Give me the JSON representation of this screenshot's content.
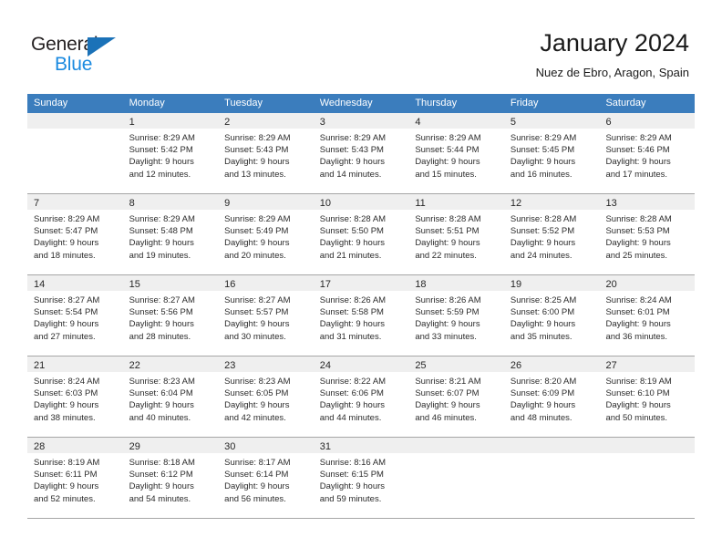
{
  "logo": {
    "word1": "General",
    "word2": "Blue",
    "triangle_color": "#1b72b8",
    "word1_color": "#231f20",
    "word2_color": "#1b8ae0"
  },
  "header": {
    "title": "January 2024",
    "subtitle": "Nuez de Ebro, Aragon, Spain"
  },
  "theme": {
    "header_row_bg": "#3b7dbd",
    "header_row_text": "#ffffff",
    "day_band_bg": "#efefef",
    "row_divider": "#a6a6a6"
  },
  "calendar": {
    "weekdays": [
      "Sunday",
      "Monday",
      "Tuesday",
      "Wednesday",
      "Thursday",
      "Friday",
      "Saturday"
    ],
    "weeks": [
      [
        {
          "day": "",
          "lines": []
        },
        {
          "day": "1",
          "lines": [
            "Sunrise: 8:29 AM",
            "Sunset: 5:42 PM",
            "Daylight: 9 hours",
            "and 12 minutes."
          ]
        },
        {
          "day": "2",
          "lines": [
            "Sunrise: 8:29 AM",
            "Sunset: 5:43 PM",
            "Daylight: 9 hours",
            "and 13 minutes."
          ]
        },
        {
          "day": "3",
          "lines": [
            "Sunrise: 8:29 AM",
            "Sunset: 5:43 PM",
            "Daylight: 9 hours",
            "and 14 minutes."
          ]
        },
        {
          "day": "4",
          "lines": [
            "Sunrise: 8:29 AM",
            "Sunset: 5:44 PM",
            "Daylight: 9 hours",
            "and 15 minutes."
          ]
        },
        {
          "day": "5",
          "lines": [
            "Sunrise: 8:29 AM",
            "Sunset: 5:45 PM",
            "Daylight: 9 hours",
            "and 16 minutes."
          ]
        },
        {
          "day": "6",
          "lines": [
            "Sunrise: 8:29 AM",
            "Sunset: 5:46 PM",
            "Daylight: 9 hours",
            "and 17 minutes."
          ]
        }
      ],
      [
        {
          "day": "7",
          "lines": [
            "Sunrise: 8:29 AM",
            "Sunset: 5:47 PM",
            "Daylight: 9 hours",
            "and 18 minutes."
          ]
        },
        {
          "day": "8",
          "lines": [
            "Sunrise: 8:29 AM",
            "Sunset: 5:48 PM",
            "Daylight: 9 hours",
            "and 19 minutes."
          ]
        },
        {
          "day": "9",
          "lines": [
            "Sunrise: 8:29 AM",
            "Sunset: 5:49 PM",
            "Daylight: 9 hours",
            "and 20 minutes."
          ]
        },
        {
          "day": "10",
          "lines": [
            "Sunrise: 8:28 AM",
            "Sunset: 5:50 PM",
            "Daylight: 9 hours",
            "and 21 minutes."
          ]
        },
        {
          "day": "11",
          "lines": [
            "Sunrise: 8:28 AM",
            "Sunset: 5:51 PM",
            "Daylight: 9 hours",
            "and 22 minutes."
          ]
        },
        {
          "day": "12",
          "lines": [
            "Sunrise: 8:28 AM",
            "Sunset: 5:52 PM",
            "Daylight: 9 hours",
            "and 24 minutes."
          ]
        },
        {
          "day": "13",
          "lines": [
            "Sunrise: 8:28 AM",
            "Sunset: 5:53 PM",
            "Daylight: 9 hours",
            "and 25 minutes."
          ]
        }
      ],
      [
        {
          "day": "14",
          "lines": [
            "Sunrise: 8:27 AM",
            "Sunset: 5:54 PM",
            "Daylight: 9 hours",
            "and 27 minutes."
          ]
        },
        {
          "day": "15",
          "lines": [
            "Sunrise: 8:27 AM",
            "Sunset: 5:56 PM",
            "Daylight: 9 hours",
            "and 28 minutes."
          ]
        },
        {
          "day": "16",
          "lines": [
            "Sunrise: 8:27 AM",
            "Sunset: 5:57 PM",
            "Daylight: 9 hours",
            "and 30 minutes."
          ]
        },
        {
          "day": "17",
          "lines": [
            "Sunrise: 8:26 AM",
            "Sunset: 5:58 PM",
            "Daylight: 9 hours",
            "and 31 minutes."
          ]
        },
        {
          "day": "18",
          "lines": [
            "Sunrise: 8:26 AM",
            "Sunset: 5:59 PM",
            "Daylight: 9 hours",
            "and 33 minutes."
          ]
        },
        {
          "day": "19",
          "lines": [
            "Sunrise: 8:25 AM",
            "Sunset: 6:00 PM",
            "Daylight: 9 hours",
            "and 35 minutes."
          ]
        },
        {
          "day": "20",
          "lines": [
            "Sunrise: 8:24 AM",
            "Sunset: 6:01 PM",
            "Daylight: 9 hours",
            "and 36 minutes."
          ]
        }
      ],
      [
        {
          "day": "21",
          "lines": [
            "Sunrise: 8:24 AM",
            "Sunset: 6:03 PM",
            "Daylight: 9 hours",
            "and 38 minutes."
          ]
        },
        {
          "day": "22",
          "lines": [
            "Sunrise: 8:23 AM",
            "Sunset: 6:04 PM",
            "Daylight: 9 hours",
            "and 40 minutes."
          ]
        },
        {
          "day": "23",
          "lines": [
            "Sunrise: 8:23 AM",
            "Sunset: 6:05 PM",
            "Daylight: 9 hours",
            "and 42 minutes."
          ]
        },
        {
          "day": "24",
          "lines": [
            "Sunrise: 8:22 AM",
            "Sunset: 6:06 PM",
            "Daylight: 9 hours",
            "and 44 minutes."
          ]
        },
        {
          "day": "25",
          "lines": [
            "Sunrise: 8:21 AM",
            "Sunset: 6:07 PM",
            "Daylight: 9 hours",
            "and 46 minutes."
          ]
        },
        {
          "day": "26",
          "lines": [
            "Sunrise: 8:20 AM",
            "Sunset: 6:09 PM",
            "Daylight: 9 hours",
            "and 48 minutes."
          ]
        },
        {
          "day": "27",
          "lines": [
            "Sunrise: 8:19 AM",
            "Sunset: 6:10 PM",
            "Daylight: 9 hours",
            "and 50 minutes."
          ]
        }
      ],
      [
        {
          "day": "28",
          "lines": [
            "Sunrise: 8:19 AM",
            "Sunset: 6:11 PM",
            "Daylight: 9 hours",
            "and 52 minutes."
          ]
        },
        {
          "day": "29",
          "lines": [
            "Sunrise: 8:18 AM",
            "Sunset: 6:12 PM",
            "Daylight: 9 hours",
            "and 54 minutes."
          ]
        },
        {
          "day": "30",
          "lines": [
            "Sunrise: 8:17 AM",
            "Sunset: 6:14 PM",
            "Daylight: 9 hours",
            "and 56 minutes."
          ]
        },
        {
          "day": "31",
          "lines": [
            "Sunrise: 8:16 AM",
            "Sunset: 6:15 PM",
            "Daylight: 9 hours",
            "and 59 minutes."
          ]
        },
        {
          "day": "",
          "lines": []
        },
        {
          "day": "",
          "lines": []
        },
        {
          "day": "",
          "lines": []
        }
      ]
    ]
  }
}
